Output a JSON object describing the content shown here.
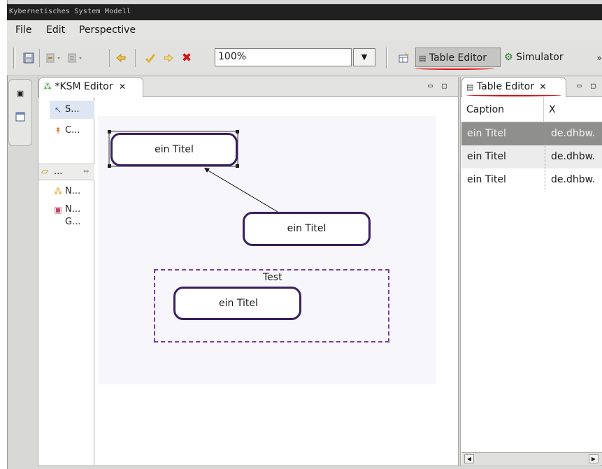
{
  "window": {
    "title": "Kybernetisches System Modell"
  },
  "menu": [
    "File",
    "Edit",
    "Perspective"
  ],
  "toolbar": {
    "zoom_value": "100%",
    "icons": [
      "save-icon",
      "undo-icon",
      "redo-icon",
      "back-icon",
      "checkmark-icon",
      "forward-icon",
      "delete-icon"
    ],
    "perspectives": [
      {
        "label": "Table Editor",
        "icon": "table-icon",
        "active": true
      },
      {
        "label": "Simulator",
        "icon": "simulator-icon",
        "active": false
      }
    ],
    "overflow_label": "»"
  },
  "editor": {
    "tab_label": "*KSM Editor",
    "palette": [
      {
        "label": "S...",
        "icon": "select-arrow-icon"
      },
      {
        "label": "C...",
        "icon": "connection-icon"
      },
      {
        "label": "...",
        "icon": "folder-icon"
      },
      {
        "label": "N...",
        "icon": "node-icon"
      },
      {
        "label": "N...",
        "icon": "node-group-icon"
      },
      {
        "label": "G...",
        "icon": ""
      }
    ],
    "diagram": {
      "nodes": [
        "ein Titel",
        "ein Titel",
        "ein Titel"
      ],
      "group_label": "Test"
    }
  },
  "table_editor": {
    "tab_label": "Table Editor",
    "columns": [
      "Caption",
      "X"
    ],
    "rows": [
      [
        "ein Titel",
        "de.dhbw."
      ],
      [
        "ein Titel",
        "de.dhbw."
      ],
      [
        "ein Titel",
        "de.dhbw."
      ]
    ],
    "selected_row": 0
  },
  "colors": {
    "node_border": "#3a1f5e",
    "group_border": "#7b3aa8",
    "selected_row": "#8f8f8d",
    "highlight_underline": "#e01010"
  }
}
